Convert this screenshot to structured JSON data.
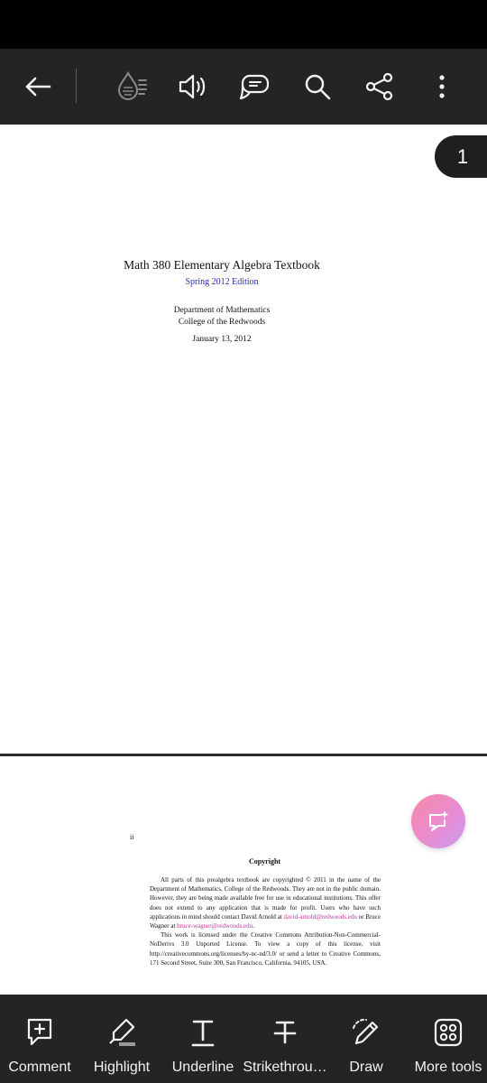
{
  "toolbar": {
    "back_icon": "back-arrow-icon",
    "icons": [
      "liquid-mode-icon",
      "read-aloud-icon",
      "comments-icon",
      "search-icon",
      "share-icon",
      "more-vertical-icon"
    ]
  },
  "viewer": {
    "page_number": "1"
  },
  "page1": {
    "title": "Math 380 Elementary Algebra Textbook",
    "edition": "Spring 2012 Edition",
    "department": "Department of Mathematics",
    "college": "College of the Redwoods",
    "date": "January 13, 2012"
  },
  "page2": {
    "page_label": "ii",
    "heading": "Copyright",
    "para1_a": "All parts of this prealgebra textbook are copyrighted © 2011 in the name of the Department of Mathematics, College of the Redwoods. They are not in the public domain. However, they are being made available free for use in educational institutions. This offer does not extend to any application that is made for profit. Users who have such applications in mind should contact David Arnold at ",
    "email1": "david-arnold@redwoods.edu",
    "para1_b": " or Bruce Wagner at ",
    "email2": "bruce-wagner@redwoods.edu",
    "para1_c": ".",
    "para2": "This work is licensed under the Creative Commons Attribution-Non-Commercial-NoDerivs 3.0 Unported License. To view a copy of this license, visit http://creativecommons.org/licenses/by-nc-nd/3.0/ or send a letter to Creative Commons, 171 Second Street, Suite 300, San Francisco, California, 94105, USA."
  },
  "bottom_toolbar": {
    "items": [
      {
        "label": "Comment",
        "icon": "comment-add-icon"
      },
      {
        "label": "Highlight",
        "icon": "highlight-icon"
      },
      {
        "label": "Underline",
        "icon": "underline-icon"
      },
      {
        "label": "Strikethrou…",
        "icon": "strikethrough-icon"
      },
      {
        "label": "Draw",
        "icon": "draw-icon"
      },
      {
        "label": "More tools",
        "icon": "more-tools-icon"
      }
    ]
  },
  "colors": {
    "toolbar_bg": "#242424",
    "link_blue": "#2a2ab0",
    "email_magenta": "#c0329a"
  }
}
